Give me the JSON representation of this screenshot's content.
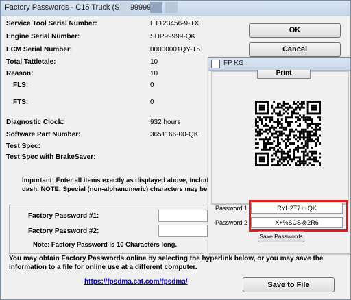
{
  "window": {
    "title": "Factory Passwords - C15 Truck (SDP99999)"
  },
  "fields": [
    {
      "label": "Service Tool Serial Number:",
      "value": "ET123456-9-TX"
    },
    {
      "label": "Engine Serial Number:",
      "value": "SDP99999-QK"
    },
    {
      "label": "ECM Serial Number:",
      "value": "00000001QY-T5"
    },
    {
      "label": "Total Tattletale:",
      "value": "10"
    },
    {
      "label": "Reason:",
      "value": "10"
    },
    {
      "label": "FLS:",
      "value": "0"
    },
    {
      "label": "FTS:",
      "value": "0"
    },
    {
      "label": "Diagnostic Clock:",
      "value": "932 hours"
    },
    {
      "label": "Software Part Number:",
      "value": "3651166-00-QK"
    },
    {
      "label": "Test Spec:",
      "value": ""
    },
    {
      "label": "Test Spec with BrakeSaver:",
      "value": ""
    }
  ],
  "buttons": {
    "ok": "OK",
    "cancel": "Cancel",
    "print": "Print",
    "save_to_file": "Save to File"
  },
  "notes": {
    "important": "Important: Enter all items exactly as displayed above, including the dash and characters after the dash.  NOTE: Special (non-alphanumeric) characters may be entered using the special keypad.",
    "length": "Note: Factory Password is 10 Characters long.",
    "online": "You may obtain Factory Passwords online by selecting the hyperlink below, or you may save the information to a file for online use at a different computer."
  },
  "factory_passwords": {
    "label1": "Factory Password #1:",
    "label2": "Factory Password #2:"
  },
  "link": "https://fpsdma.cat.com/fpsdma/",
  "fpkg": {
    "title": "FP KG",
    "password1_label": "Password 1",
    "password1": "RYH2T7++QK",
    "password2_label": "Password 2",
    "password2": "X+%SCS@2R6",
    "save_button": "Save Passwords",
    "highlight_color": "#e01818"
  }
}
